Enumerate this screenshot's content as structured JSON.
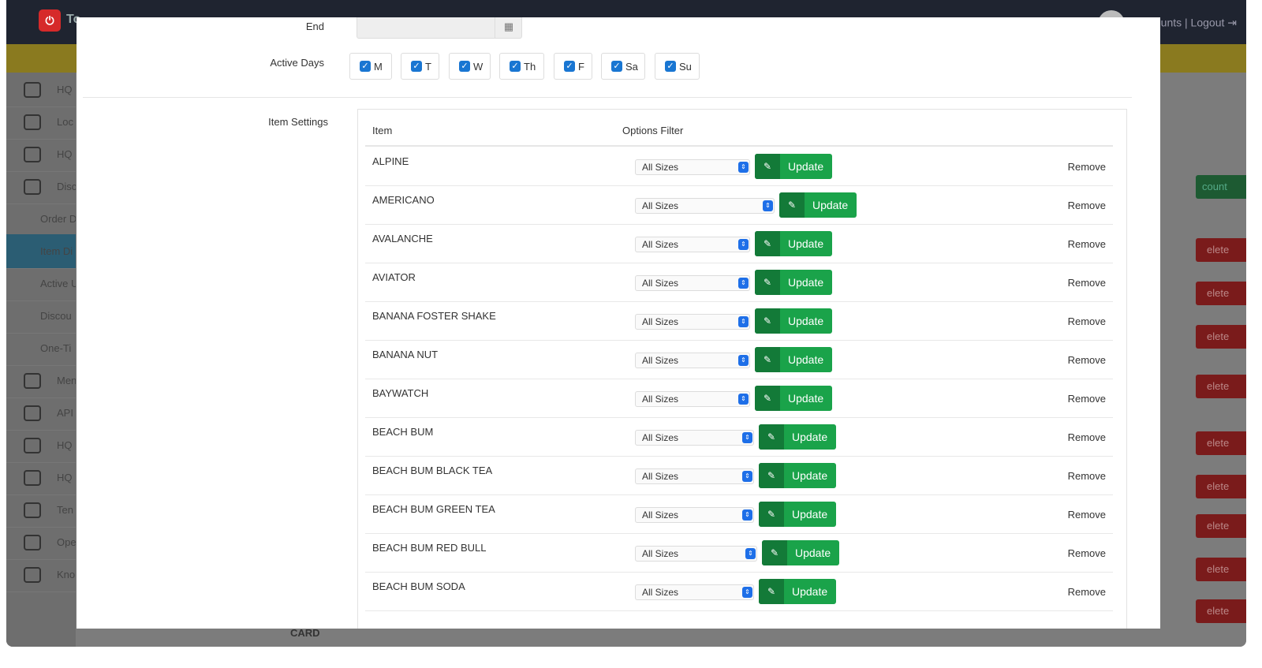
{
  "app": {
    "brand": "To",
    "topbar_links": "| Accounts | Logout",
    "sidebar": {
      "items": [
        {
          "label": "HQ",
          "icon": "building-icon"
        },
        {
          "label": "Loc",
          "icon": "globe-icon"
        },
        {
          "label": "HQ",
          "icon": "book-icon"
        },
        {
          "label": "Disc",
          "icon": "discount-icon"
        },
        {
          "label": "Order D",
          "sub": true
        },
        {
          "label": "Item Di",
          "sub": true,
          "active": true
        },
        {
          "label": "Active U",
          "sub": true
        },
        {
          "label": "Discou",
          "sub": true
        },
        {
          "label": "One-Ti",
          "sub": true
        },
        {
          "label": "Men",
          "icon": "heart-icon"
        },
        {
          "label": "API",
          "icon": "cloud-icon"
        },
        {
          "label": "HQ",
          "icon": "people-icon"
        },
        {
          "label": "HQ",
          "icon": "chart-icon"
        },
        {
          "label": "Ten",
          "icon": "store-icon"
        },
        {
          "label": "Ope",
          "icon": "tools-icon"
        },
        {
          "label": "Kno",
          "icon": "database-icon"
        }
      ]
    },
    "bg_button_green": "count",
    "bg_button_delete": "elete",
    "bg_card_label": "CARD"
  },
  "modal": {
    "end_label": "End",
    "end_value": "",
    "active_days_label": "Active Days",
    "days": [
      {
        "label": "M",
        "checked": true
      },
      {
        "label": "T",
        "checked": true
      },
      {
        "label": "W",
        "checked": true
      },
      {
        "label": "Th",
        "checked": true
      },
      {
        "label": "F",
        "checked": true
      },
      {
        "label": "Sa",
        "checked": true
      },
      {
        "label": "Su",
        "checked": true
      }
    ],
    "item_settings_label": "Item Settings",
    "table": {
      "col_item": "Item",
      "col_options": "Options Filter",
      "update_label": "Update",
      "remove_label": "Remove",
      "rows": [
        {
          "name": "ALPINE",
          "option": "All Sizes"
        },
        {
          "name": "AMERICANO",
          "option": "All Sizes"
        },
        {
          "name": "AVALANCHE",
          "option": "All Sizes"
        },
        {
          "name": "AVIATOR",
          "option": "All Sizes"
        },
        {
          "name": "BANANA FOSTER SHAKE",
          "option": "All Sizes"
        },
        {
          "name": "BANANA NUT",
          "option": "All Sizes"
        },
        {
          "name": "BAYWATCH",
          "option": "All Sizes"
        },
        {
          "name": "BEACH BUM",
          "option": "All Sizes"
        },
        {
          "name": "BEACH BUM BLACK TEA",
          "option": "All Sizes"
        },
        {
          "name": "BEACH BUM GREEN TEA",
          "option": "All Sizes"
        },
        {
          "name": "BEACH BUM RED BULL",
          "option": "All Sizes"
        },
        {
          "name": "BEACH BUM SODA",
          "option": "All Sizes"
        }
      ]
    }
  },
  "colors": {
    "update_green": "#1aa34a",
    "update_green_dark": "#137a38",
    "checkbox_blue": "#1976d2"
  }
}
